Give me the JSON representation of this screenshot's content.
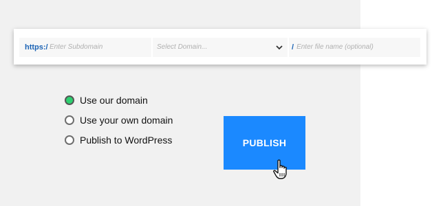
{
  "url_bar": {
    "protocol": "https://",
    "subdomain_placeholder": "Enter Subdomain",
    "domain_select_placeholder": "Select Domain...",
    "separator": "/",
    "filename_placeholder": "Enter file name (optional)"
  },
  "publish_options": [
    {
      "label": "Use our domain",
      "selected": true
    },
    {
      "label": "Use your own domain",
      "selected": false
    },
    {
      "label": "Publish to WordPress",
      "selected": false
    }
  ],
  "publish_button": {
    "label": "PUBLISH"
  },
  "colors": {
    "accent": "#1b89ff",
    "protocol_text": "#1b63b5",
    "radio_selected": "#2ed070",
    "panel_background": "#f1f1f1"
  },
  "icons": {
    "dropdown": "chevron-down-icon",
    "cursor": "hand-pointer-icon"
  }
}
